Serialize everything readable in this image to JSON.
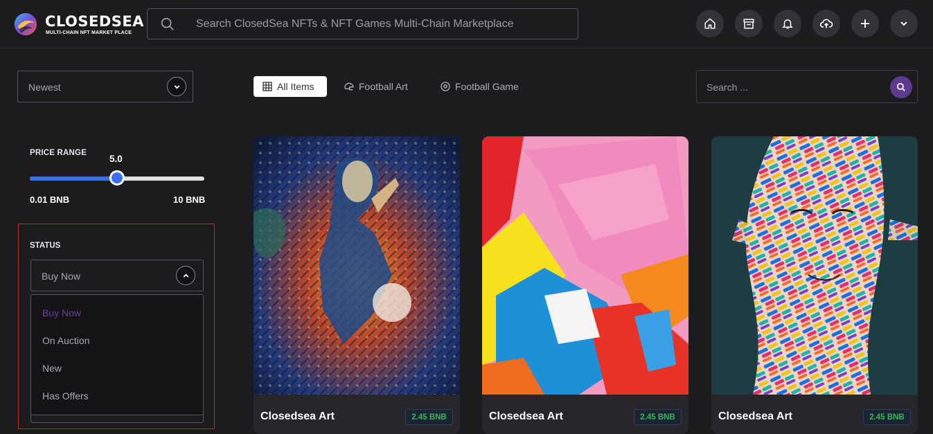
{
  "header": {
    "logo_title": "CLOSEDSEA",
    "logo_subtitle": "MULTI-CHAIN NFT MARKET PLACE",
    "search_placeholder": "Search ClosedSea NFTs & NFT Games Multi-Chain Marketplace",
    "icons": [
      "home-icon",
      "store-icon",
      "bell-icon",
      "cloud-upload-icon",
      "plus-icon",
      "chevron-down-icon"
    ]
  },
  "sort": {
    "value": "Newest"
  },
  "price_range": {
    "label": "PRICE RANGE",
    "value_text": "5.0",
    "value": 5.0,
    "min": 0.01,
    "max": 10,
    "min_label": "0.01 BNB",
    "max_label": "10 BNB"
  },
  "status": {
    "label": "STATUS",
    "selected": "Buy Now",
    "options": [
      "Buy Now",
      "On Auction",
      "New",
      "Has Offers"
    ]
  },
  "tabs": [
    {
      "label": "All Items",
      "icon": "grid-icon",
      "active": true
    },
    {
      "label": "Football Art",
      "icon": "helmet-icon",
      "active": false
    },
    {
      "label": "Football Game",
      "icon": "soccer-ball-icon",
      "active": false
    }
  ],
  "side_search": {
    "placeholder": "Search ..."
  },
  "cards": [
    {
      "title": "Closedsea Art",
      "price": "2.45 BNB"
    },
    {
      "title": "Closedsea Art",
      "price": "2.45 BNB"
    },
    {
      "title": "Closedsea Art",
      "price": "2.45 BNB"
    }
  ],
  "colors": {
    "background": "#1c1c1f",
    "accent_blue": "#3b6ef5",
    "accent_purple": "#5e3a8f",
    "price_green": "#36b75a",
    "highlight_red": "#c2262a"
  }
}
